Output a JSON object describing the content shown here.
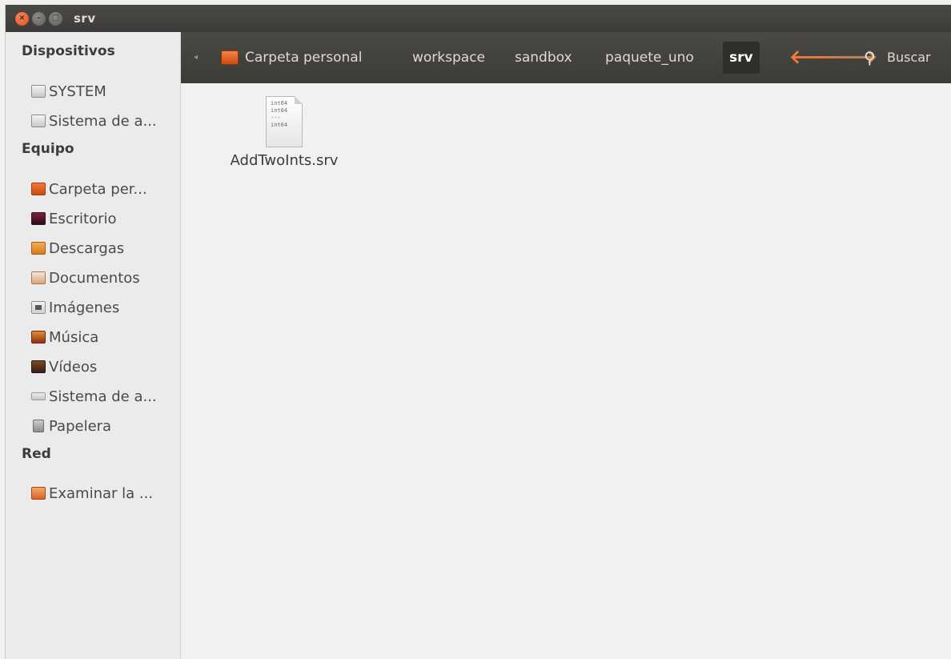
{
  "window": {
    "title": "srv",
    "buttons": {
      "close": "×",
      "minimize": "–",
      "maximize": "□"
    }
  },
  "sidebar": {
    "sections": [
      {
        "heading": "Dispositivos",
        "items": [
          {
            "label": "SYSTEM",
            "icon": "drive-icon"
          },
          {
            "label": "Sistema de a...",
            "icon": "drive-icon"
          }
        ]
      },
      {
        "heading": "Equipo",
        "items": [
          {
            "label": "Carpeta per...",
            "icon": "home-folder-icon"
          },
          {
            "label": "Escritorio",
            "icon": "desktop-icon"
          },
          {
            "label": "Descargas",
            "icon": "downloads-folder-icon"
          },
          {
            "label": "Documentos",
            "icon": "documents-folder-icon"
          },
          {
            "label": "Imágenes",
            "icon": "pictures-folder-icon"
          },
          {
            "label": "Música",
            "icon": "music-folder-icon"
          },
          {
            "label": "Vídeos",
            "icon": "videos-folder-icon"
          },
          {
            "label": "Sistema de a...",
            "icon": "filesystem-icon"
          },
          {
            "label": "Papelera",
            "icon": "trash-icon"
          }
        ]
      },
      {
        "heading": "Red",
        "items": [
          {
            "label": "Examinar la ...",
            "icon": "network-icon"
          }
        ]
      }
    ]
  },
  "toolbar": {
    "breadcrumbs": [
      "Carpeta personal",
      "workspace",
      "sandbox",
      "paquete_uno",
      "srv"
    ],
    "back_glyph": "🡐",
    "forward_glyph": "🡒",
    "search_label": "Buscar"
  },
  "content": {
    "files": [
      {
        "name": "AddTwoInts.srv",
        "preview_lines": [
          "int64",
          "int64",
          "---",
          "int64"
        ]
      }
    ]
  },
  "colors": {
    "titlebar": "#3c3b37",
    "accent_orange": "#f07c3a",
    "background": "#f2f1f0"
  }
}
